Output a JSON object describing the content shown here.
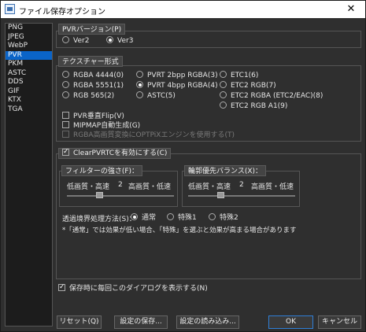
{
  "window": {
    "title": "ファイル保存オプション",
    "close_glyph": "✕"
  },
  "formats": [
    "PNG",
    "JPEG",
    "WebP",
    "PVR",
    "PKM",
    "ASTC",
    "DDS",
    "GIF",
    "KTX",
    "TGA"
  ],
  "selected_format": "PVR",
  "pvr_version": {
    "header": "PVRバージョン(P)",
    "options": [
      "Ver2",
      "Ver3"
    ],
    "selected": "Ver3"
  },
  "texture_format": {
    "header": "テクスチャー形式",
    "col1": [
      "RGBA 4444(0)",
      "RGBA 5551(1)",
      "RGB 565(2)"
    ],
    "col2": [
      "PVRT 2bpp RGBA(3)",
      "PVRT 4bpp RGBA(4)",
      "ASTC(5)"
    ],
    "col3": [
      "ETC1(6)",
      "ETC2 RGB(7)",
      "ETC2 RGBA (ETC2/EAC)(8)",
      "ETC2 RGB A1(9)"
    ],
    "selected": "PVRT 4bpp RGBA(4)",
    "flip_label": "PVR垂直Flip(V)",
    "mipmap_label": "MIPMAP自動生成(G)",
    "highquality_label": "RGBA高画質変換にOPTPiXエンジンを使用する(T)"
  },
  "clear_pvrtc": {
    "label": "ClearPVRTCを有効にする(C)",
    "filter": {
      "header": "フィルターの強さ(F)：",
      "left": "低画質・高速",
      "value": "2",
      "right": "高画質・低速",
      "level": 0.3
    },
    "contour": {
      "header": "輪郭優先バランス(X)：",
      "left": "低画質・高速",
      "value": "2",
      "right": "高画質・低速",
      "level": 0.3
    },
    "transparency_label": "透過境界処理方法(S)：",
    "transparency_options": [
      "通常",
      "特殊1",
      "特殊2"
    ],
    "transparency_selected": "通常",
    "note": "*「通常」では効果が低い場合、「特殊」を選ぶと効果が高まる場合があります"
  },
  "show_dialog_label": "保存時に毎回このダイアログを表示する(N)",
  "buttons": {
    "reset": "リセット(Q)",
    "save_settings": "設定の保存...",
    "load_settings": "設定の読み込み...",
    "ok": "OK",
    "cancel": "キャンセル"
  }
}
